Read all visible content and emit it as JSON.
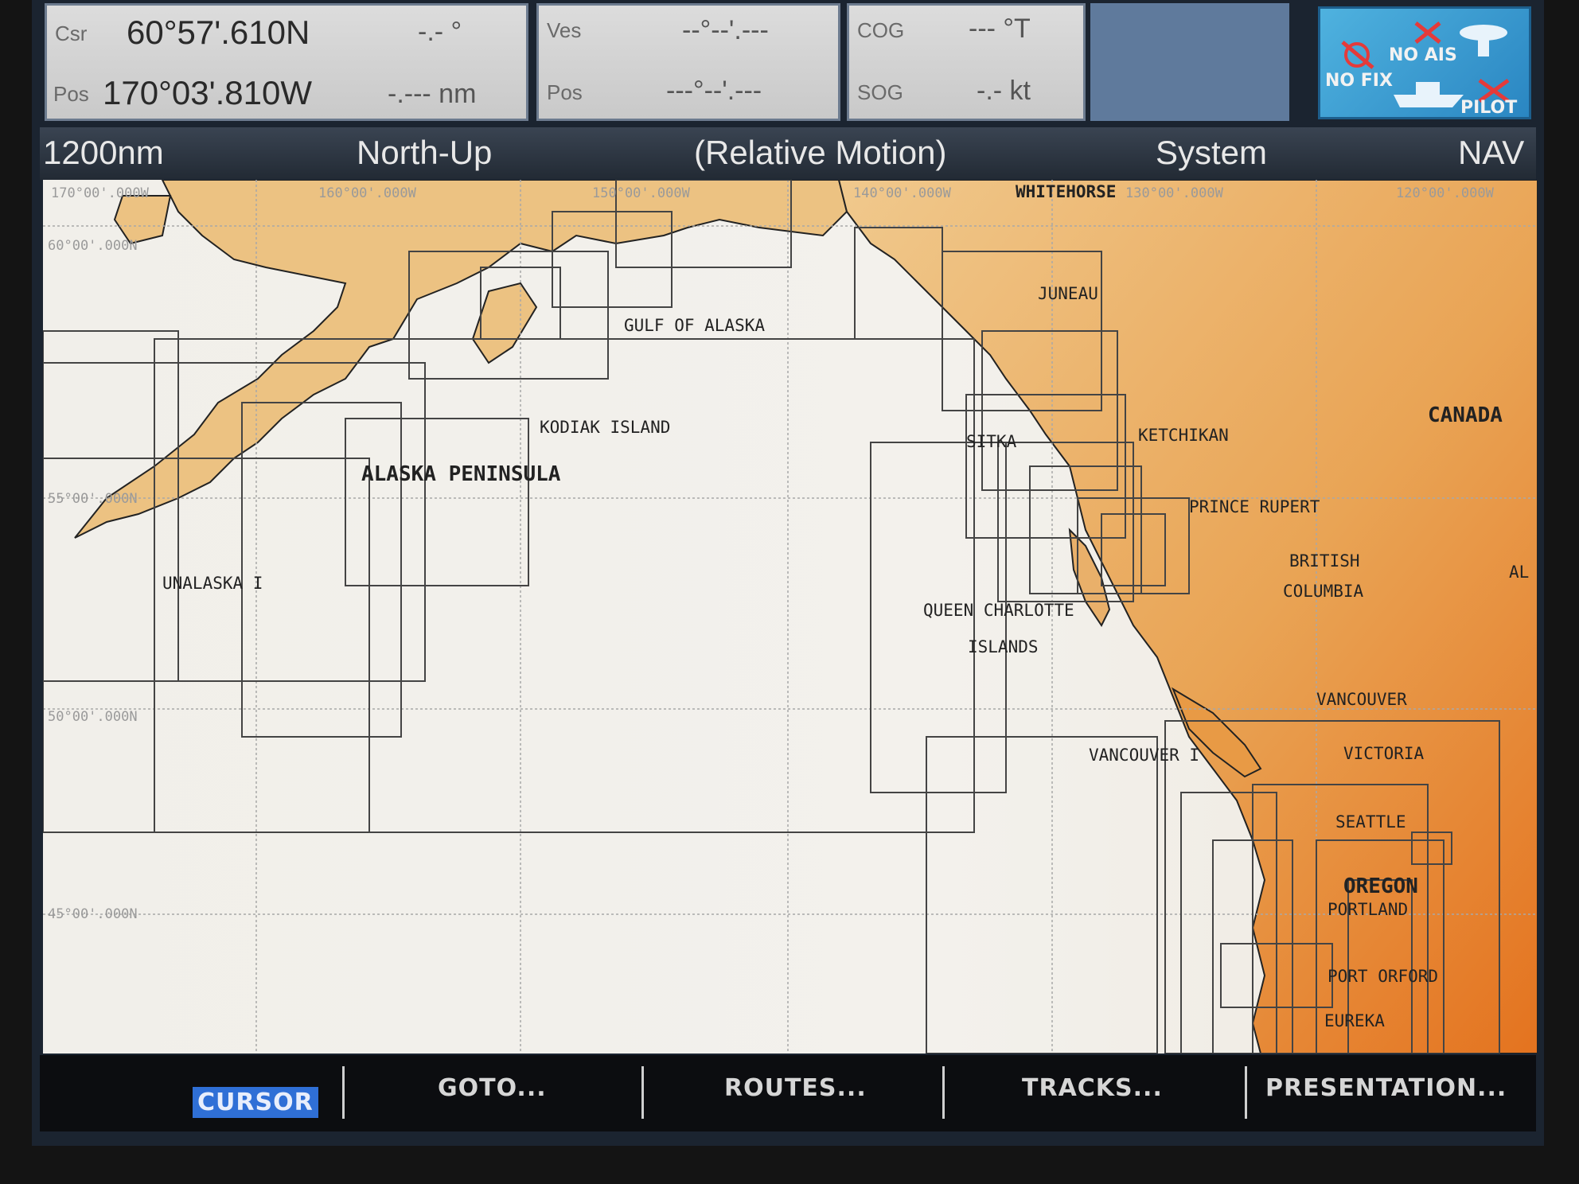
{
  "cursor_panel": {
    "csr_label": "Csr",
    "lat": "60°57'.610N",
    "bearing": "-.- °",
    "pos_label": "Pos",
    "lon": "170°03'.810W",
    "range": "-.--- nm"
  },
  "vessel_panel": {
    "ves_label": "Ves",
    "ves_val": "--°--'.---",
    "pos_label": "Pos",
    "pos_val": "---°--'.---"
  },
  "course_panel": {
    "cog_label": "COG",
    "cog_val": "--- °T",
    "sog_label": "SOG",
    "sog_val": "-.- kt"
  },
  "status_panel": {
    "no_fix": "NO FIX",
    "no_ais": "NO AIS",
    "pilot": "PILOT"
  },
  "header": {
    "range": "1200nm",
    "orientation": "North-Up",
    "motion": "(Relative Motion)",
    "system": "System",
    "mode": "NAV"
  },
  "chart_labels": {
    "gulf_of_alaska": "GULF OF ALASKA",
    "kodiak_island": "KODIAK ISLAND",
    "alaska_peninsula": "ALASKA PENINSULA",
    "unalaska": "UNALASKA I",
    "whitehorse": "WHITEHORSE",
    "juneau": "JUNEAU",
    "sitka": "SITKA",
    "ketchikan": "KETCHIKAN",
    "canada": "CANADA",
    "prince_rupert": "PRINCE RUPERT",
    "british": "BRITISH",
    "columbia": "COLUMBIA",
    "queen_charlotte": "QUEEN CHARLOTTE",
    "islands": "ISLANDS",
    "vancouver": "VANCOUVER",
    "vancouver_i": "VANCOUVER I",
    "victoria": "VICTORIA",
    "seattle": "SEATTLE",
    "oregon": "OREGON",
    "portland": "PORTLAND",
    "port_orford": "PORT ORFORD",
    "eureka": "EUREKA",
    "al": "AL"
  },
  "grid_labels": {
    "lon_170": "170°00'.000W",
    "lon_160": "160°00'.000W",
    "lon_150": "150°00'.000W",
    "lon_140": "140°00'.000W",
    "lon_130": "130°00'.000W",
    "lon_120": "120°00'.000W",
    "lat_60": "60°00'.000N",
    "lat_55": "55°00'.000N",
    "lat_50": "50°00'.000N",
    "lat_45": "45°00'.000N"
  },
  "softkeys": {
    "cursor": "CURSOR",
    "goto": "GOTO...",
    "routes": "ROUTES...",
    "tracks": "TRACKS...",
    "presentation": "PRESENTATION..."
  },
  "colors": {
    "land_tan": "#e8b877",
    "land_orange": "#e98a32",
    "sea": "#f2f0eb",
    "cursor_key": "#2f6fd6"
  }
}
